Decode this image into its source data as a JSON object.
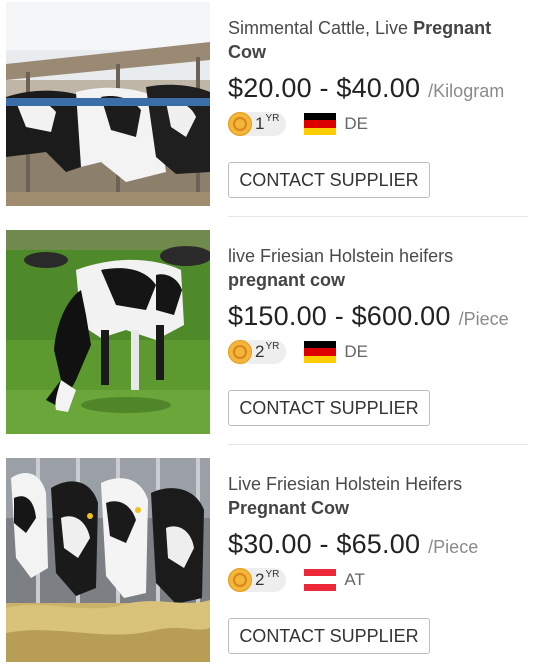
{
  "products": [
    {
      "title_plain": "Simmental Cattle, Live ",
      "title_bold": "Pregnant Cow",
      "price": "$20.00 - $40.00",
      "unit": "/Kilogram",
      "years": "1",
      "years_suffix": "YR",
      "country": "DE",
      "flag_colors": [
        "#000000",
        "#dd0000",
        "#ffce00"
      ],
      "button": "CONTACT SUPPLIER",
      "image": "cows-in-barn-photo"
    },
    {
      "title_plain": "live Friesian Holstein heifers ",
      "title_bold": "pregnant cow",
      "price": "$150.00 - $600.00",
      "unit": "/Piece",
      "years": "2",
      "years_suffix": "YR",
      "country": "DE",
      "flag_colors": [
        "#000000",
        "#dd0000",
        "#ffce00"
      ],
      "button": "CONTACT SUPPLIER",
      "image": "cow-grazing-field-photo"
    },
    {
      "title_plain": "Live Friesian Holstein Heifers ",
      "title_bold": "Pregnant Cow",
      "price": "$30.00 - $65.00",
      "unit": "/Piece",
      "years": "2",
      "years_suffix": "YR",
      "country": "AT",
      "flag_colors": [
        "#ed2939",
        "#ffffff",
        "#ed2939"
      ],
      "button": "CONTACT SUPPLIER",
      "image": "cows-feeding-hay-photo"
    }
  ]
}
